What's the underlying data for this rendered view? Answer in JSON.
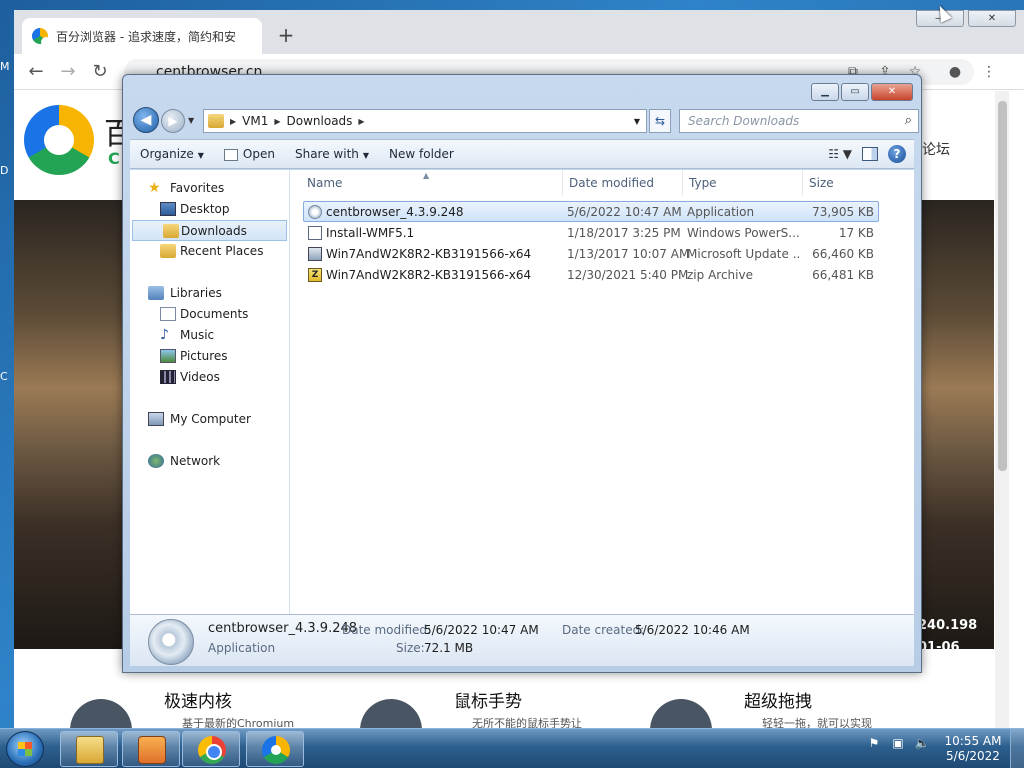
{
  "desktop": {
    "frag_m": "M",
    "frag_d": "D",
    "frag_c": "C"
  },
  "browser": {
    "tab_title": "百分浏览器 - 追求速度，简约和安全",
    "newtab": "+",
    "win_min": "—",
    "win_max": "❐",
    "win_close": "✕",
    "nav": {
      "back": "←",
      "forward": "→",
      "reload": "↻"
    },
    "url": "centbrowser.cn",
    "toolbar_icons": {
      "translate": "⧉",
      "share": "⇪",
      "bookmark": "☆",
      "profile": "●",
      "menu": "⋮"
    },
    "page": {
      "logo_frag1": "百",
      "logo_frag2": "C",
      "forum": "论坛",
      "hero_text1": "240.198",
      "hero_text2": "01-06",
      "features": [
        {
          "title": "极速内核",
          "sub": "基于最新的Chromium"
        },
        {
          "title": "鼠标手势",
          "sub": "无所不能的鼠标手势让"
        },
        {
          "title": "超级拖拽",
          "sub": "轻轻一拖，就可以实现"
        }
      ]
    }
  },
  "explorer": {
    "caption": {
      "min": "▁",
      "max": "▭",
      "close": "✕"
    },
    "address": {
      "segments": [
        "VM1",
        "Downloads"
      ]
    },
    "search_placeholder": "Search Downloads",
    "commands": {
      "organize": "Organize",
      "open": "Open",
      "share_with": "Share with",
      "new_folder": "New folder"
    },
    "nav": {
      "favorites": "Favorites",
      "desktop": "Desktop",
      "downloads": "Downloads",
      "recent_places": "Recent Places",
      "libraries": "Libraries",
      "documents": "Documents",
      "music": "Music",
      "pictures": "Pictures",
      "videos": "Videos",
      "my_computer": "My Computer",
      "network": "Network"
    },
    "columns": {
      "name": "Name",
      "date": "Date modified",
      "type": "Type",
      "size": "Size"
    },
    "files": [
      {
        "name": "centbrowser_4.3.9.248",
        "date": "5/6/2022 10:47 AM",
        "type": "Application",
        "size": "73,905 KB",
        "icon": "app-icon"
      },
      {
        "name": "Install-WMF5.1",
        "date": "1/18/2017 3:25 PM",
        "type": "Windows PowerS...",
        "size": "17 KB",
        "icon": "powershell-script-icon"
      },
      {
        "name": "Win7AndW2K8R2-KB3191566-x64",
        "date": "1/13/2017 10:07 AM",
        "type": "Microsoft Update ...",
        "size": "66,460 KB",
        "icon": "update-package-icon"
      },
      {
        "name": "Win7AndW2K8R2-KB3191566-x64",
        "date": "12/30/2021 5:40 PM",
        "type": "zip Archive",
        "size": "66,481 KB",
        "icon": "zip-archive-icon"
      }
    ],
    "details": {
      "name": "centbrowser_4.3.9.248",
      "type": "Application",
      "date_modified_label": "Date modified:",
      "date_modified": "5/6/2022 10:47 AM",
      "date_created_label": "Date created:",
      "date_created": "5/6/2022 10:46 AM",
      "size_label": "Size:",
      "size": "72.1 MB"
    }
  },
  "taskbar": {
    "time": "10:55 AM",
    "date": "5/6/2022",
    "tray": {
      "flag": "⚑",
      "network": "▣",
      "volume": "🔈"
    }
  }
}
